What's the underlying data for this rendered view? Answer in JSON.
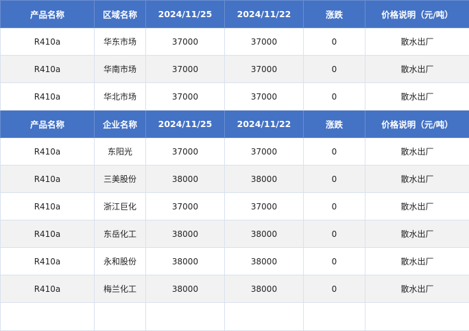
{
  "tables": [
    {
      "headers": [
        "产品名称",
        "区域名称",
        "2024/11/25",
        "2024/11/22",
        "涨跌",
        "价格说明（元/吨）"
      ],
      "rows": [
        [
          "R410a",
          "华东市场",
          "37000",
          "37000",
          "0",
          "散水出厂"
        ],
        [
          "R410a",
          "华南市场",
          "37000",
          "37000",
          "0",
          "散水出厂"
        ],
        [
          "R410a",
          "华北市场",
          "37000",
          "37000",
          "0",
          "散水出厂"
        ]
      ]
    },
    {
      "headers": [
        "产品名称",
        "企业名称",
        "2024/11/25",
        "2024/11/22",
        "涨跌",
        "价格说明（元/吨）"
      ],
      "rows": [
        [
          "R410a",
          "东阳光",
          "37000",
          "37000",
          "0",
          "散水出厂"
        ],
        [
          "R410a",
          "三美股份",
          "38000",
          "38000",
          "0",
          "散水出厂"
        ],
        [
          "R410a",
          "浙江巨化",
          "37000",
          "37000",
          "0",
          "散水出厂"
        ],
        [
          "R410a",
          "东岳化工",
          "38000",
          "38000",
          "0",
          "散水出厂"
        ],
        [
          "R410a",
          "永和股份",
          "38000",
          "38000",
          "0",
          "散水出厂"
        ],
        [
          "R410a",
          "梅兰化工",
          "38000",
          "38000",
          "0",
          "散水出厂"
        ]
      ]
    }
  ]
}
